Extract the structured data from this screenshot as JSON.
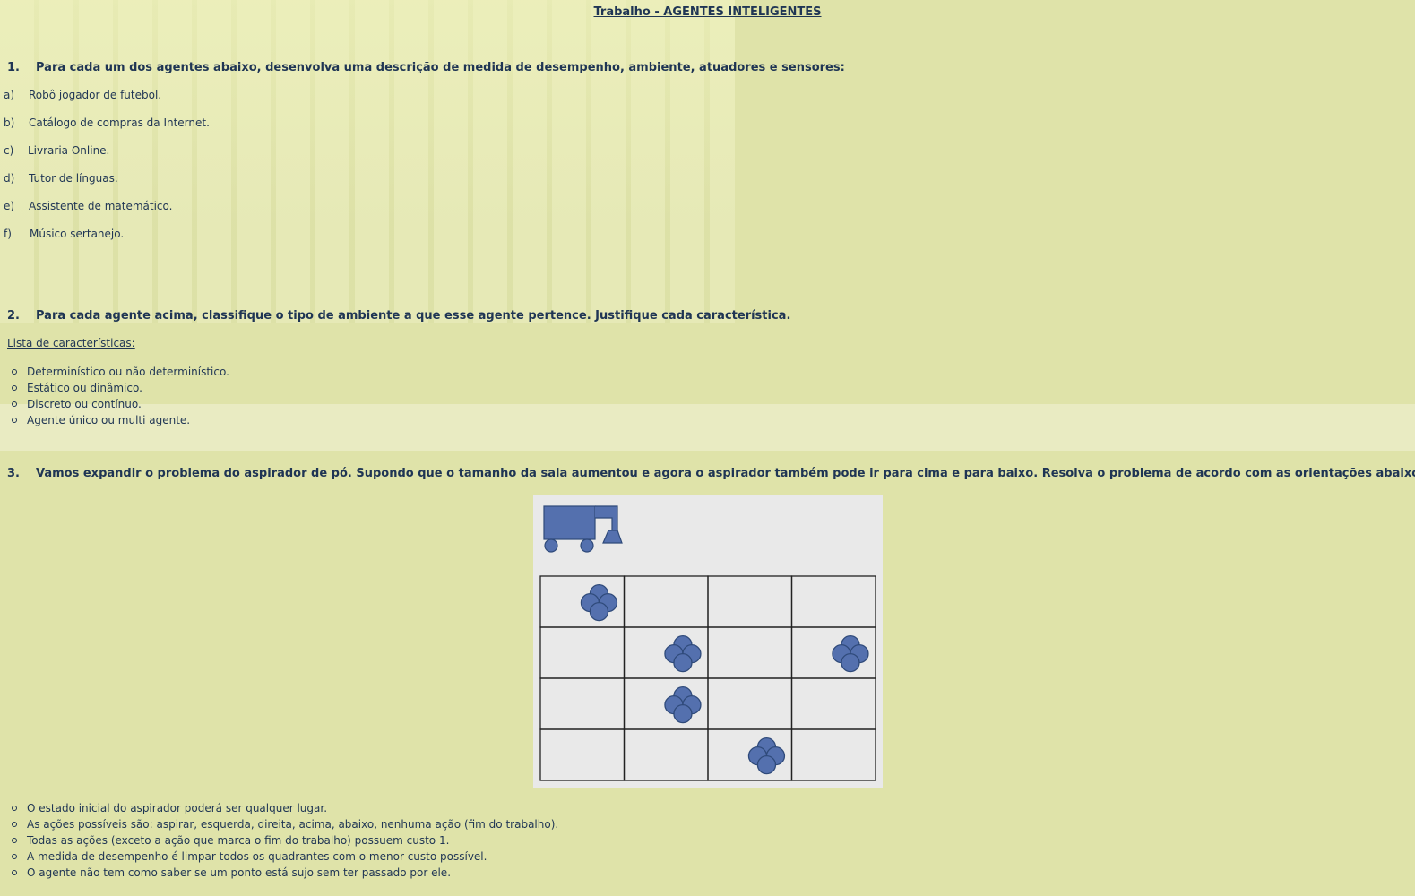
{
  "title": "Trabalho - AGENTES INTELIGENTES",
  "q1": {
    "number": "1.",
    "text": "Para cada um dos agentes abaixo, desenvolva uma descrição de medida de desempenho, ambiente, atuadores e sensores:",
    "items": [
      {
        "letter": "a)",
        "text": "Robô jogador de futebol."
      },
      {
        "letter": "b)",
        "text": "Catálogo de compras da Internet."
      },
      {
        "letter": "c)",
        "text": "Livraria Online."
      },
      {
        "letter": "d)",
        "text": "Tutor de línguas."
      },
      {
        "letter": "e)",
        "text": "Assistente de matemático."
      },
      {
        "letter": "f)",
        "text": "Músico sertanejo."
      }
    ]
  },
  "q2": {
    "number": "2.",
    "text": "Para cada agente acima, classifique o tipo de ambiente a que esse agente pertence. Justifique cada característica.",
    "list_title": "Lista de características:",
    "bullets": [
      "Determinístico ou não determinístico.",
      "Estático ou dinâmico.",
      "Discreto ou contínuo.",
      "Agente único ou multi agente."
    ]
  },
  "q3": {
    "number": "3.",
    "text": "Vamos expandir o problema do aspirador de pó. Supondo que o tamanho da sala aumentou e agora o aspirador também pode ir para cima e para baixo. Resolva o problema de acordo com as orientações abaixo:",
    "figure": {
      "icons": [
        "vacuum-cleaner-icon",
        "dirt-icon"
      ],
      "grid_rows": 4,
      "grid_cols": 4,
      "dirt_cells": [
        [
          0,
          0
        ],
        [
          1,
          1
        ],
        [
          1,
          3
        ],
        [
          2,
          1
        ],
        [
          3,
          2
        ]
      ],
      "fill_color": "#5470ae",
      "stroke_color": "#2f4a7a",
      "figure_bg": "#e9e9e9"
    },
    "bullets": [
      "O estado inicial do aspirador poderá ser qualquer lugar.",
      "As ações possíveis são: aspirar, esquerda, direita, acima, abaixo, nenhuma ação (fim do trabalho).",
      "Todas as ações (exceto a ação que marca o fim do trabalho) possuem custo 1.",
      "A medida de desempenho é limpar todos os quadrantes com o menor custo possível.",
      "O agente não tem como saber se um ponto está sujo sem ter passado por ele."
    ]
  },
  "colors": {
    "page_bg": "#dfe3a9",
    "text": "#1f3554"
  }
}
